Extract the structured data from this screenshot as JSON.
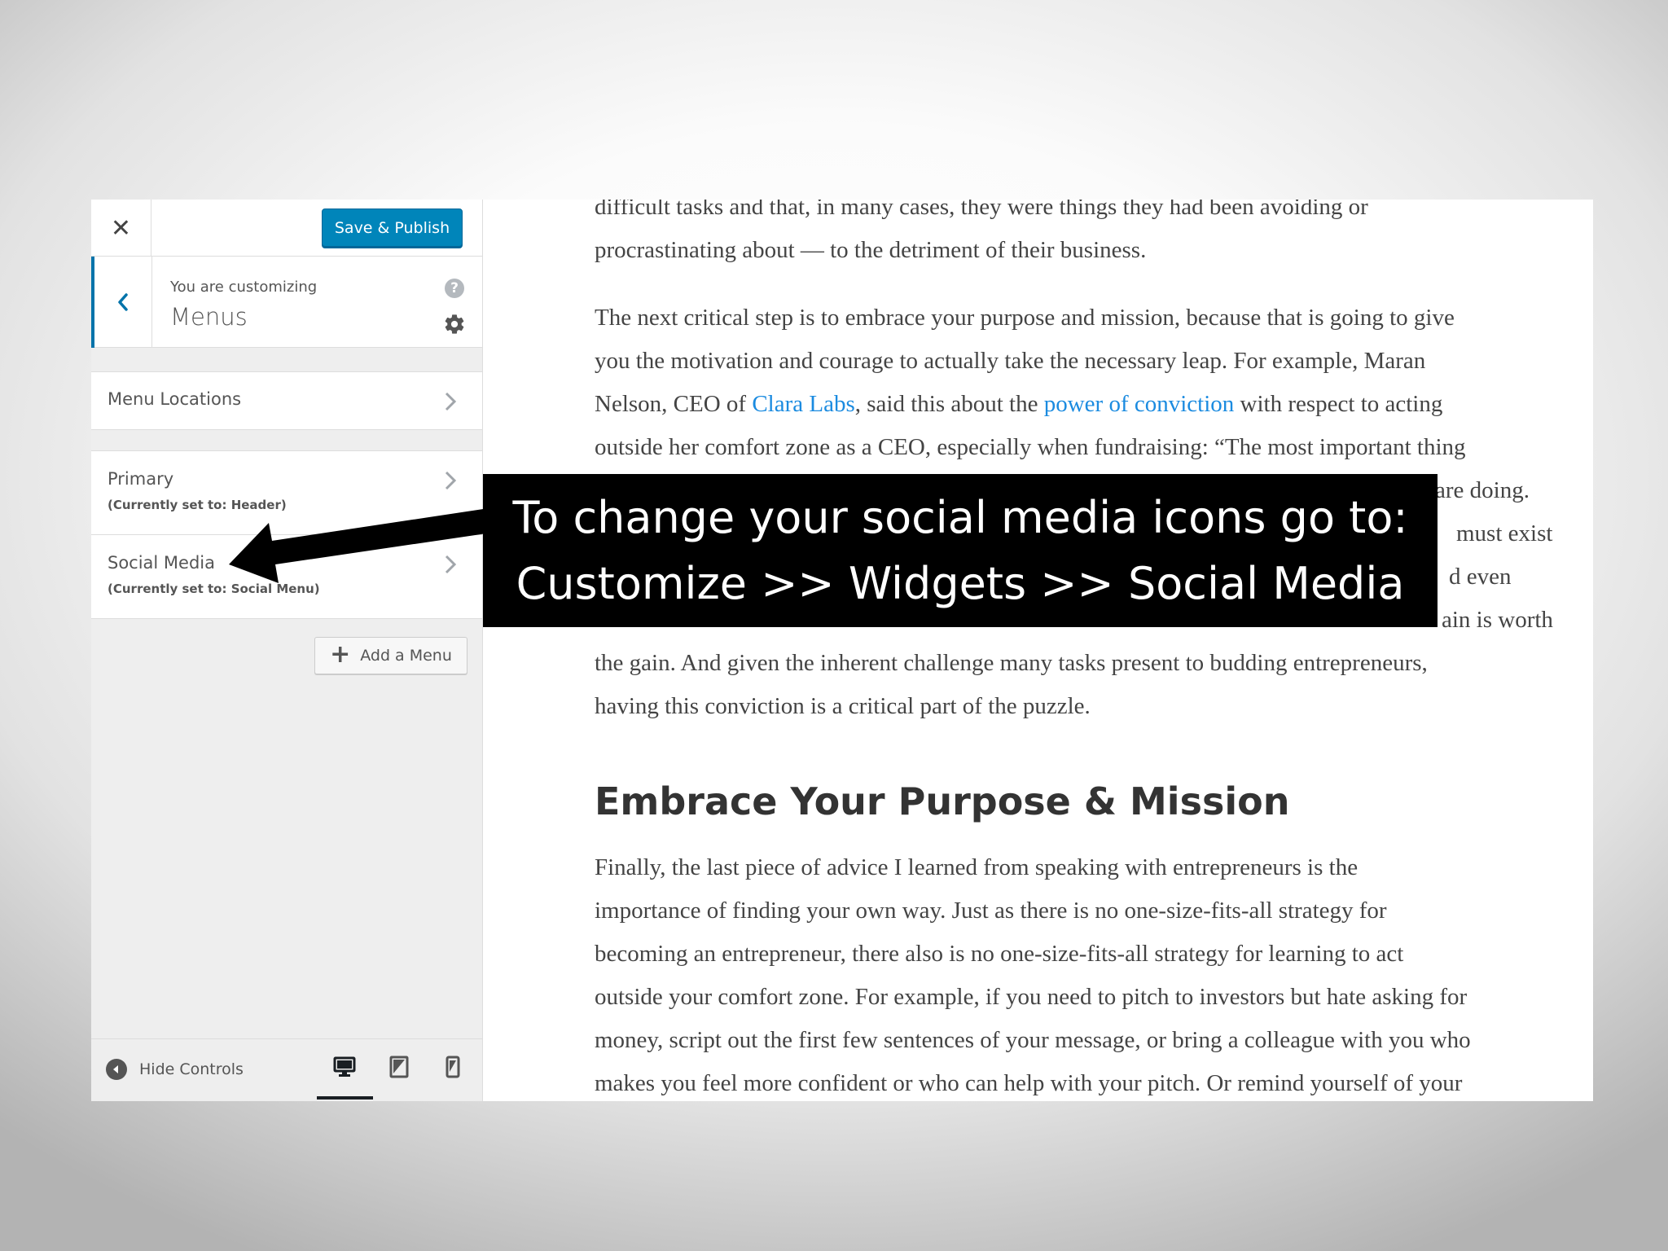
{
  "sidebar": {
    "close_glyph": "✕",
    "save_publish": "Save & Publish",
    "customizing_prefix": "You are customizing",
    "customizing_title": "Menus",
    "help_glyph": "?",
    "menu_locations": "Menu Locations",
    "menus": [
      {
        "label": "Primary",
        "sub": "(Currently set to: Header)"
      },
      {
        "label": "Social Media",
        "sub": "(Currently set to: Social Menu)"
      }
    ],
    "add_menu_plus": "+",
    "add_menu": "Add a Menu",
    "hide_controls": "Hide Controls",
    "devices": [
      "desktop",
      "tablet",
      "mobile"
    ],
    "active_device": "desktop"
  },
  "article": {
    "p1_l1": "difficult tasks and that, in many cases, they were things they had been avoiding or",
    "p1_l2": "procrastinating about — to the detriment of their business.",
    "p2_l1": "The next critical step is to embrace your purpose and mission, because that is going to give",
    "p2_l2": "you the motivation and courage to actually take the necessary leap. For example, Maran",
    "p2_l3_a": "Nelson, CEO of ",
    "p2_l3_link1": "Clara Labs",
    "p2_l3_b": ", said this about the ",
    "p2_l3_link2": "power of conviction",
    "p2_l3_c": " with respect to acting",
    "p2_l4": "outside her comfort zone as a CEO, especially when fundraising: “The most important thing",
    "p2_l5": "are doing.",
    "p2_l6": "must exist",
    "p2_l7": "d even",
    "p2_l8": "ain is worth",
    "p2_l9": "the gain. And given the inherent challenge many tasks present to budding entrepreneurs,",
    "p2_l10": "having this conviction is a critical part of the puzzle.",
    "heading": "Embrace Your Purpose & Mission",
    "p3_l1": "Finally, the last piece of advice I learned from speaking with entrepreneurs is the",
    "p3_l2": "importance of finding your own way. Just as there is no one-size-fits-all strategy for",
    "p3_l3": "becoming an entrepreneur, there also is no one-size-fits-all strategy for learning to act",
    "p3_l4": "outside your comfort zone. For example, if you need to pitch to investors but hate asking for",
    "p3_l5": "money, script out the first few sentences of your message, or bring a colleague with you who",
    "p3_l6": "makes you feel more confident or who can help with your pitch. Or remind yourself of your"
  },
  "callout": {
    "line1": "To change your social media icons go to:",
    "line2": "Customize >> Widgets >> Social Media"
  },
  "colors": {
    "primary_button": "#0085ba",
    "link": "#1b8be0",
    "accent_border": "#0073aa",
    "callout_bg": "#000000"
  }
}
